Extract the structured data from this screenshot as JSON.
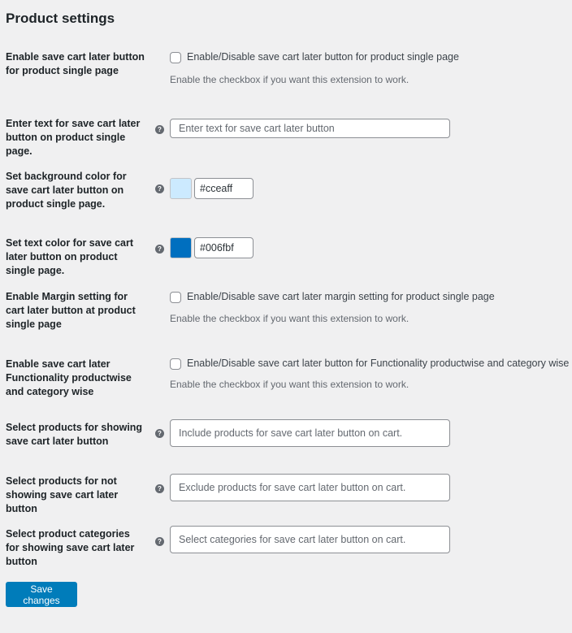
{
  "page": {
    "title": "Product settings"
  },
  "settings": [
    {
      "label": "Enable save cart later button for product single page",
      "type": "checkbox",
      "checkbox_label": "Enable/Disable save cart later button for product single page",
      "checked": false,
      "description": "Enable the checkbox if you want this extension to work."
    },
    {
      "label": "Enter text for save cart later button on product single page.",
      "type": "text",
      "value": "",
      "placeholder": "Enter text for save cart later button",
      "help_icon": "question-circle-icon"
    },
    {
      "label": "Set background color for save cart later button on product single page.",
      "type": "color",
      "value": "#cceaff",
      "swatch_color": "#cceaff",
      "help_icon": "question-circle-icon"
    },
    {
      "label": "Set text color for save cart later button on product single page.",
      "type": "color",
      "value": "#006fbf",
      "swatch_color": "#006fbf",
      "help_icon": "question-circle-icon"
    },
    {
      "label": "Enable Margin setting for cart later button at product single page",
      "type": "checkbox",
      "checkbox_label": "Enable/Disable save cart later margin setting for product single page",
      "checked": false,
      "description": "Enable the checkbox if you want this extension to work."
    },
    {
      "label": "Enable save cart later Functionality productwise and category wise",
      "type": "checkbox",
      "checkbox_label": "Enable/Disable save cart later button for Functionality productwise and category wise",
      "checked": false,
      "description": "Enable the checkbox if you want this extension to work."
    },
    {
      "label": "Select products for showing save cart later button",
      "type": "select",
      "placeholder": "Include products for save cart later button on cart.",
      "help_icon": "question-circle-icon"
    },
    {
      "label": "Select products for not showing save cart later button",
      "type": "select",
      "placeholder": "Exclude products for save cart later button on cart.",
      "help_icon": "question-circle-icon"
    },
    {
      "label": "Select product categories for showing save cart later button",
      "type": "select",
      "placeholder": "Select categories for save cart later button on cart.",
      "help_icon": "question-circle-icon"
    }
  ],
  "help_glyph": "?",
  "footer": {
    "save_label": "Save changes"
  },
  "colors": {
    "accent": "#007cba",
    "background": "#f0f0f1"
  }
}
